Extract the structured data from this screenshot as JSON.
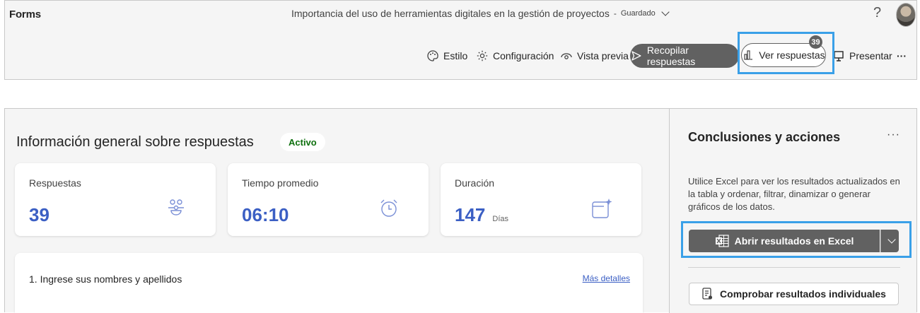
{
  "header": {
    "brand": "Forms",
    "doc_title": "Importancia del uso de herramientas digitales en la gestión de proyectos",
    "doc_sep": "-",
    "save_status": "Guardado",
    "help": "?"
  },
  "toolbar": {
    "style": "Estilo",
    "settings": "Configuración",
    "preview": "Vista previa",
    "collect": "Recopilar respuestas",
    "view_responses": "Ver respuestas",
    "view_badge": "39",
    "present": "Presentar",
    "more": "···"
  },
  "overview": {
    "title": "Información general sobre respuestas",
    "status": "Activo",
    "stats": [
      {
        "label": "Respuestas",
        "value": "39",
        "unit": ""
      },
      {
        "label": "Tiempo promedio",
        "value": "06:10",
        "unit": ""
      },
      {
        "label": "Duración",
        "value": "147",
        "unit": "Días"
      }
    ]
  },
  "question": {
    "text": "1. Ingrese sus nombres y apellidos",
    "link": "Más detalles"
  },
  "panel": {
    "title": "Conclusiones y acciones",
    "more": "···",
    "description": "Utilice Excel para ver los resultados actualizados en la tabla y ordenar, filtrar, dinamizar o generar gráficos de los datos.",
    "excel_button": "Abrir resultados en Excel",
    "check_button": "Comprobar resultados individuales"
  },
  "colors": {
    "accent": "#3b5fc4",
    "active_green": "#0e700e",
    "highlight": "#3aa0e8",
    "dark_button": "#616161"
  }
}
